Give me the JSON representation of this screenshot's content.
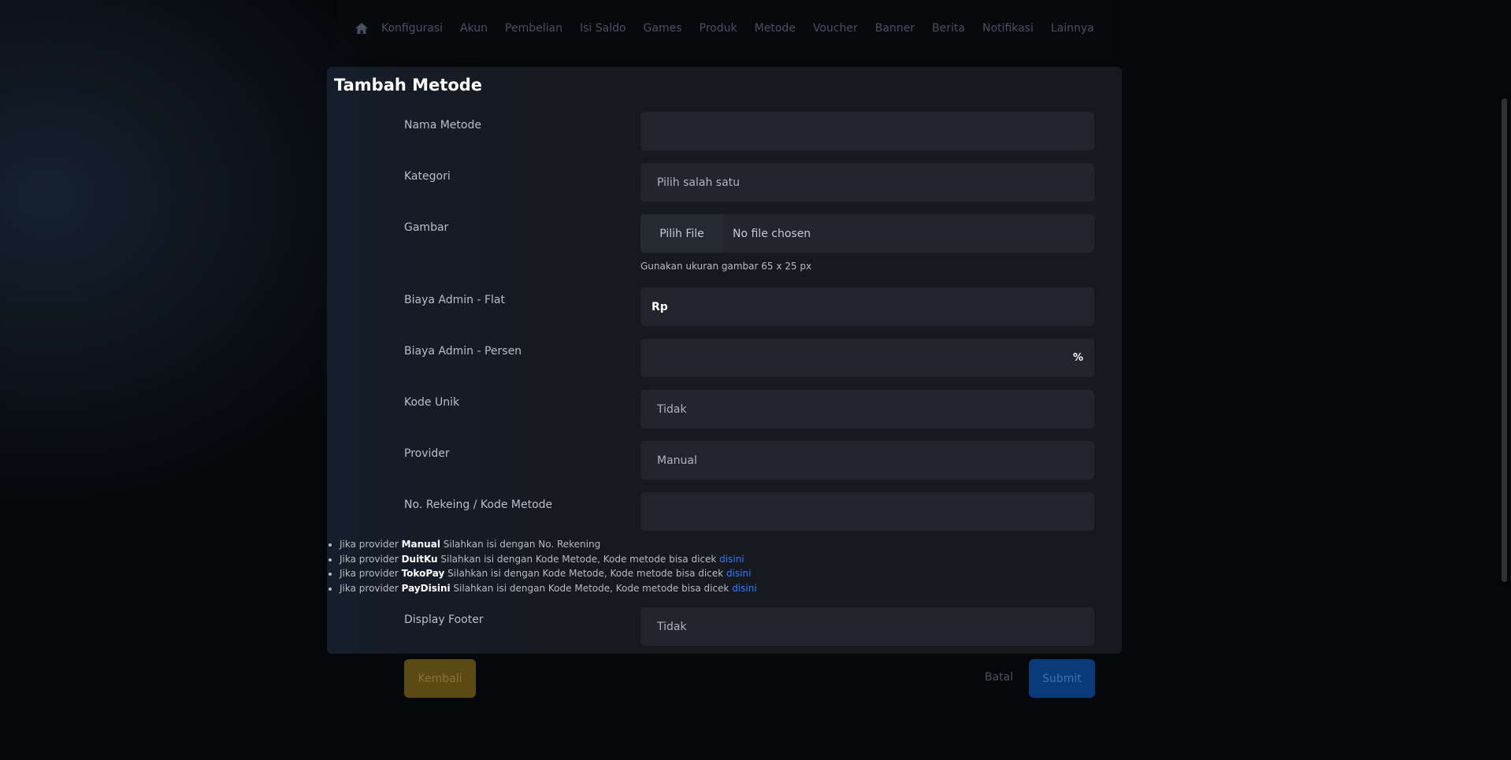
{
  "nav": {
    "home_icon": "home-icon",
    "items": [
      "Konfigurasi",
      "Akun",
      "Pembelian",
      "Isi Saldo",
      "Games",
      "Produk",
      "Metode",
      "Voucher",
      "Banner",
      "Berita",
      "Notifikasi",
      "Lainnya"
    ]
  },
  "form": {
    "title": "Tambah Metode",
    "nama_metode": {
      "label": "Nama Metode",
      "value": ""
    },
    "kategori": {
      "label": "Kategori",
      "value": "Pilih salah satu"
    },
    "gambar": {
      "label": "Gambar",
      "button": "Pilih File",
      "status": "No file chosen",
      "hint": "Gunakan ukuran gambar 65 x 25 px"
    },
    "biaya_flat": {
      "label": "Biaya Admin - Flat",
      "prefix": "Rp",
      "value": ""
    },
    "biaya_persen": {
      "label": "Biaya Admin - Persen",
      "suffix": "%",
      "value": ""
    },
    "kode_unik": {
      "label": "Kode Unik",
      "value": "Tidak"
    },
    "provider": {
      "label": "Provider",
      "value": "Manual"
    },
    "no_rekening": {
      "label": "No. Rekeing / Kode Metode",
      "value": "",
      "notes": [
        {
          "pre": "Jika provider ",
          "bold": "Manual",
          "post": " Silahkan isi dengan No. Rekening",
          "link": ""
        },
        {
          "pre": "Jika provider ",
          "bold": "DuitKu",
          "post": " Silahkan isi dengan Kode Metode, Kode metode bisa dicek ",
          "link": "disini"
        },
        {
          "pre": "Jika provider ",
          "bold": "TokoPay",
          "post": " Silahkan isi dengan Kode Metode, Kode metode bisa dicek ",
          "link": "disini"
        },
        {
          "pre": "Jika provider ",
          "bold": "PayDisini",
          "post": " Silahkan isi dengan Kode Metode, Kode metode bisa dicek ",
          "link": "disini"
        }
      ]
    },
    "display_footer": {
      "label": "Display Footer",
      "value": "Tidak"
    }
  },
  "actions": {
    "back": "Kembali",
    "cancel": "Batal",
    "submit": "Submit"
  },
  "colors": {
    "accent_blue": "#0a3a7a",
    "back_gold": "#5c4a14",
    "link": "#2b7cff"
  }
}
